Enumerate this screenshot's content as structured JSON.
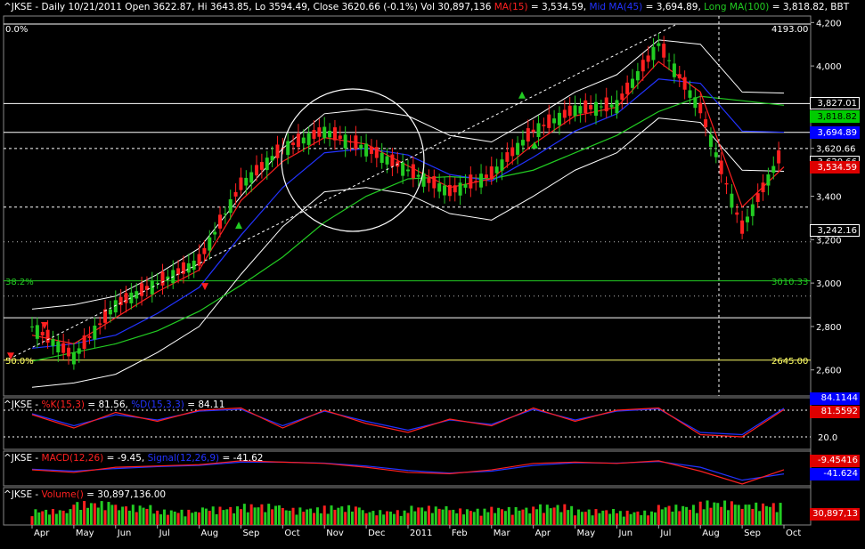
{
  "main_panel": {
    "header": [
      {
        "text": "^JKSE - Daily 10/21/2011 Open 3622.87, Hi 3643.85, Lo 3594.49, Close 3620.66 (-0.1%) Vol 30,897,136 ",
        "color": "#ffffff"
      },
      {
        "text": "MA(15)",
        "color": "#ff2020"
      },
      {
        "text": " = 3,534.59, ",
        "color": "#ffffff"
      },
      {
        "text": "Mid MA(45)",
        "color": "#2233ff"
      },
      {
        "text": " = 3,694.89, ",
        "color": "#ffffff"
      },
      {
        "text": "Long MA(100)",
        "color": "#22cc22"
      },
      {
        "text": " = 3,818.82, BBT",
        "color": "#ffffff"
      }
    ],
    "fib_levels": [
      {
        "label_left": "0.0%",
        "label_right": "4193.00",
        "value": 4193,
        "color": "#ffffff"
      },
      {
        "label_left": "38.2%",
        "label_right": "3010.33",
        "value": 3010,
        "color": "#22cc22"
      },
      {
        "label_left": "50.0%",
        "label_right": "2645.00",
        "value": 2645,
        "color": "#ffff66"
      }
    ],
    "price_tags": [
      {
        "text": "3,827.01",
        "value": 3827,
        "bg": "#000000",
        "fg": "#ffffff",
        "border": "#ffffff"
      },
      {
        "text": "3,818.82",
        "value": 3818,
        "bg": "#00cc00",
        "fg": "#000000",
        "border": "#00cc00"
      },
      {
        "text": "3,694.89",
        "value": 3694,
        "bg": "#0000ff",
        "fg": "#ffffff",
        "border": "#0000ff"
      },
      {
        "text": "3,620.66",
        "value": 3620,
        "bg": "#000000",
        "fg": "#ffffff",
        "border": "#ffffff"
      },
      {
        "text": "3,534.59",
        "value": 3534,
        "bg": "#dd0000",
        "fg": "#ffffff",
        "border": "#dd0000"
      },
      {
        "text": "3,242.16",
        "value": 3242,
        "bg": "#000000",
        "fg": "#ffffff",
        "border": "#ffffff"
      }
    ],
    "last_price_text": "3,620.66"
  },
  "stoch_panel": {
    "header": [
      {
        "text": "^JKSE - ",
        "color": "#ffffff"
      },
      {
        "text": "%K(15,3)",
        "color": "#ff2020"
      },
      {
        "text": " = 81.56, ",
        "color": "#ffffff"
      },
      {
        "text": "%D(15,3,3)",
        "color": "#2233ff"
      },
      {
        "text": " = 84.11",
        "color": "#ffffff"
      }
    ],
    "level_label": "20.0",
    "tags": [
      {
        "text": "84.1144",
        "bg": "#0000ff",
        "fg": "#ffffff"
      },
      {
        "text": "81.5592",
        "bg": "#dd0000",
        "fg": "#ffffff"
      }
    ]
  },
  "macd_panel": {
    "header": [
      {
        "text": "^JKSE - ",
        "color": "#ffffff"
      },
      {
        "text": "MACD(12,26)",
        "color": "#ff2020"
      },
      {
        "text": " = -9.45, ",
        "color": "#ffffff"
      },
      {
        "text": "Signal(12,26,9)",
        "color": "#2233ff"
      },
      {
        "text": " = -41.62",
        "color": "#ffffff"
      }
    ],
    "tags": [
      {
        "text": "-9.45416",
        "bg": "#dd0000",
        "fg": "#ffffff"
      },
      {
        "text": "-41.624",
        "bg": "#0000ff",
        "fg": "#ffffff"
      }
    ]
  },
  "volume_panel": {
    "header": [
      {
        "text": "^JKSE - ",
        "color": "#ffffff"
      },
      {
        "text": "Volume()",
        "color": "#ff2020"
      },
      {
        "text": " = 30,897,136.00",
        "color": "#ffffff"
      }
    ],
    "tags": [
      {
        "text": "30,897,13",
        "bg": "#dd0000",
        "fg": "#ffffff"
      }
    ]
  },
  "chart_data": {
    "type": "line",
    "symbol": "^JKSE",
    "title": "^JKSE - Daily 10/21/2011",
    "ohlc_last": {
      "date": "10/21/2011",
      "open": 3622.87,
      "high": 3643.85,
      "low": 3594.49,
      "close": 3620.66,
      "change_pct": -0.1,
      "volume": 30897136
    },
    "x_ticks": [
      "Apr",
      "May",
      "Jun",
      "Jul",
      "Aug",
      "Sep",
      "Oct",
      "Nov",
      "Dec",
      "2011",
      "Feb",
      "Mar",
      "Apr",
      "May",
      "Jun",
      "Jul",
      "Aug",
      "Sep",
      "Oct"
    ],
    "y_ticks": [
      2600,
      2800,
      3000,
      3200,
      3400,
      3620.66,
      4000,
      4200
    ],
    "y_tick_labels": [
      "2,600",
      "2,800",
      "3,000",
      "3,200",
      "3,400",
      "3,620.66",
      "4,000",
      "4,200"
    ],
    "ylim": [
      2480,
      4230
    ],
    "grid": false,
    "series": [
      {
        "name": "^JKSE",
        "color": "#22cc22",
        "x": [
          "Apr",
          "May",
          "Jun",
          "Jul",
          "Aug",
          "Sep",
          "Oct",
          "Nov",
          "Dec",
          "2011",
          "Feb",
          "Mar",
          "Apr",
          "May",
          "Jun",
          "Jul",
          "Aug",
          "Sep",
          "Oct"
        ],
        "values": [
          2800,
          2660,
          2900,
          3000,
          3100,
          3450,
          3620,
          3700,
          3620,
          3520,
          3420,
          3500,
          3700,
          3800,
          3820,
          4100,
          3800,
          3250,
          3620
        ]
      },
      {
        "name": "MA(15)",
        "color": "#ff2020",
        "values": [
          2760,
          2720,
          2840,
          2960,
          3060,
          3380,
          3560,
          3670,
          3640,
          3540,
          3440,
          3480,
          3640,
          3770,
          3810,
          4020,
          3880,
          3350,
          3535
        ]
      },
      {
        "name": "Mid MA(45)",
        "color": "#2233ff",
        "values": [
          2700,
          2720,
          2760,
          2860,
          2980,
          3220,
          3440,
          3600,
          3620,
          3590,
          3500,
          3470,
          3580,
          3700,
          3780,
          3940,
          3920,
          3700,
          3695
        ]
      },
      {
        "name": "Long MA(100)",
        "color": "#22cc22",
        "values": [
          2640,
          2680,
          2720,
          2780,
          2870,
          2990,
          3120,
          3280,
          3400,
          3480,
          3490,
          3480,
          3520,
          3600,
          3680,
          3790,
          3860,
          3840,
          3819
        ]
      }
    ],
    "stochastic": {
      "k_label": "%K(15,3)",
      "d_label": "%D(15,3,3)",
      "k_last": 81.56,
      "d_last": 84.11,
      "k": [
        70,
        40,
        75,
        55,
        80,
        85,
        40,
        80,
        50,
        30,
        60,
        45,
        85,
        55,
        80,
        85,
        25,
        20,
        81.56
      ],
      "d": [
        72,
        45,
        70,
        58,
        78,
        82,
        45,
        78,
        55,
        35,
        58,
        48,
        82,
        58,
        78,
        83,
        30,
        25,
        84.11
      ]
    },
    "macd": {
      "macd_label": "MACD(12,26)",
      "signal_label": "Signal(12,26,9)",
      "macd_last": -9.45,
      "signal_last": -41.62,
      "macd": [
        -10,
        -30,
        10,
        20,
        30,
        60,
        50,
        40,
        10,
        -30,
        -40,
        -10,
        40,
        50,
        40,
        60,
        -20,
        -120,
        -9.45
      ],
      "signal": [
        -5,
        -20,
        0,
        15,
        25,
        50,
        50,
        42,
        20,
        -15,
        -35,
        -20,
        25,
        45,
        42,
        55,
        10,
        -90,
        -41.62
      ]
    },
    "volume": {
      "label": "Volume()",
      "last": 30897136,
      "values": [
        30000000.0,
        45000000.0,
        38000000.0,
        29000000.0,
        35000000.0,
        40000000.0,
        33000000.0,
        37000000.0,
        28000000.0,
        36000000.0,
        31000000.0,
        34000000.0,
        39000000.0,
        30000000.0,
        27000000.0,
        38000000.0,
        46000000.0,
        42000000.0,
        30900000.0
      ]
    }
  }
}
